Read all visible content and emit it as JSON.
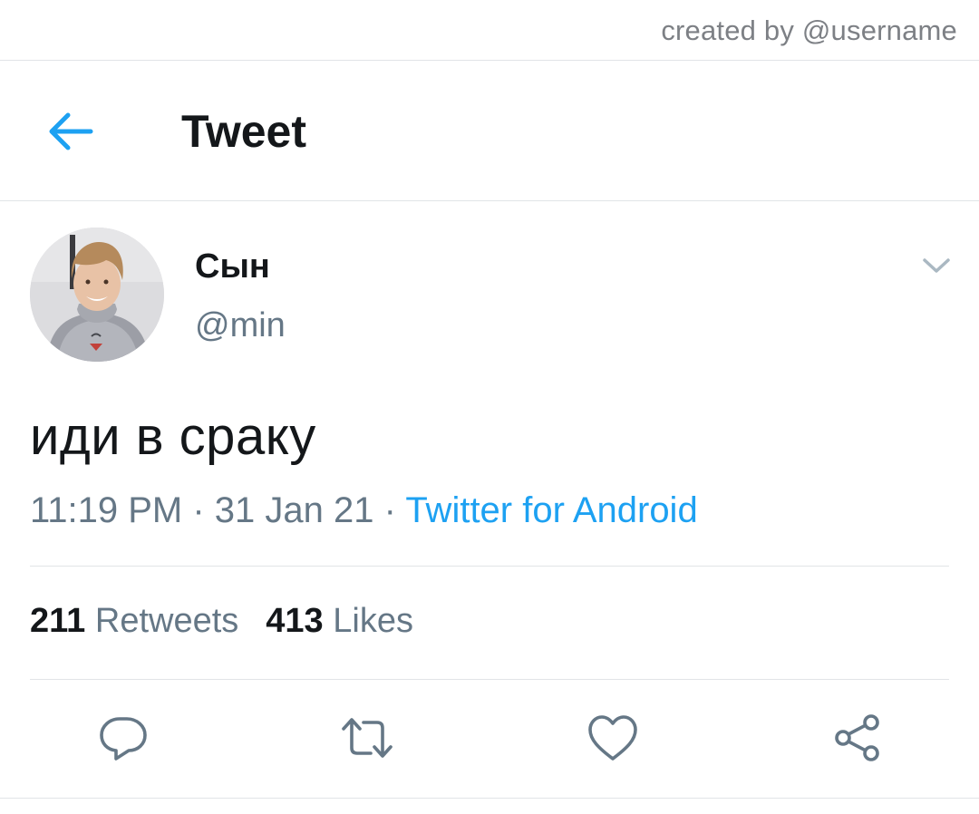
{
  "watermark": "created by @username",
  "header": {
    "back_icon": "arrow-left-icon",
    "title": "Tweet"
  },
  "tweet": {
    "display_name": "Сын",
    "handle": "@min",
    "text": "иди в сраку",
    "time": "11:19 PM",
    "separator": " · ",
    "date": "31 Jan 21",
    "source": "Twitter for Android",
    "menu_icon": "chevron-down-icon"
  },
  "stats": {
    "retweets_count": "211",
    "retweets_label": "Retweets",
    "likes_count": "413",
    "likes_label": "Likes"
  },
  "actions": [
    {
      "name": "reply",
      "icon": "speech-bubble-icon"
    },
    {
      "name": "retweet",
      "icon": "retweet-icon"
    },
    {
      "name": "like",
      "icon": "heart-icon"
    },
    {
      "name": "share",
      "icon": "share-icon"
    }
  ],
  "colors": {
    "accent": "#1da1f2",
    "text_primary": "#14171a",
    "text_secondary": "#657786",
    "icon_gray": "#657786",
    "divider": "#e1e4e7"
  }
}
